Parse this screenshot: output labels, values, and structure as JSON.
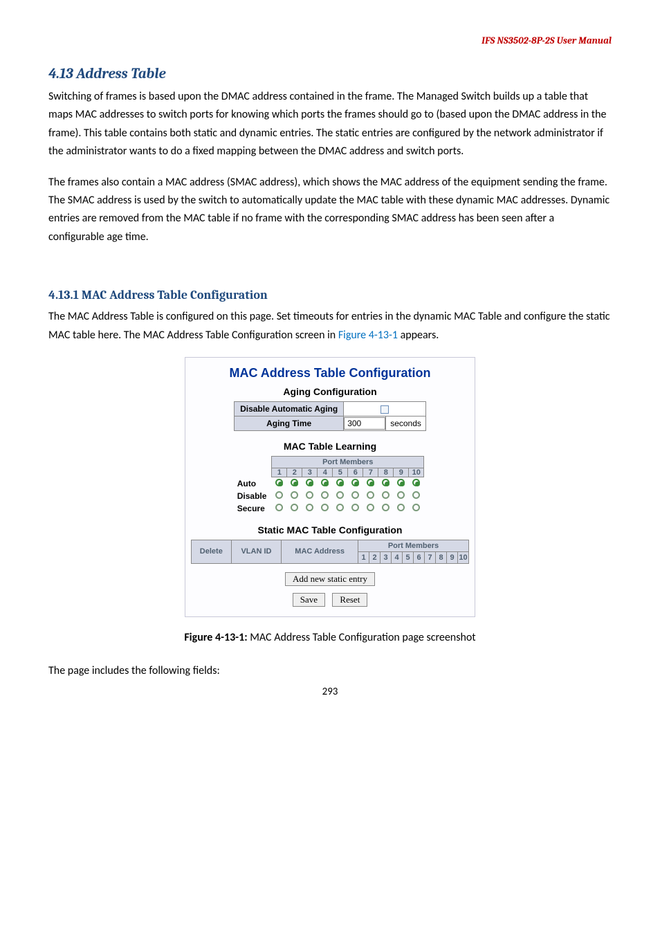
{
  "header": "IFS  NS3502-8P-2S  User  Manual",
  "section": {
    "heading": "4.13 Address Table",
    "para1": "Switching of frames is based upon the DMAC address contained in the frame. The Managed Switch builds up a table that maps MAC addresses to switch ports for knowing which ports the frames should go to (based upon the DMAC address in the frame). This table contains both static and dynamic entries. The static entries are configured by the network administrator if the administrator wants to do a fixed mapping between the DMAC address and switch ports.",
    "para2": "The frames also contain a MAC address (SMAC address), which shows the MAC address of the equipment sending the frame. The SMAC address is used by the switch to automatically update the MAC table with these dynamic MAC addresses. Dynamic entries are removed from the MAC table if no frame with the corresponding SMAC address has been seen after a configurable age time."
  },
  "subsection": {
    "heading": "4.13.1 MAC Address Table Configuration",
    "para_before_link": "The MAC Address Table is configured on this page. Set timeouts for entries in the dynamic MAC Table and configure the static MAC table here. The MAC Address Table Configuration screen in ",
    "figure_link": "Figure 4-13-1",
    "para_after_link": " appears."
  },
  "figure": {
    "title": "MAC Address Table Configuration",
    "aging_sub": "Aging Configuration",
    "aging_rows": {
      "disable_label": "Disable Automatic Aging",
      "time_label": "Aging Time",
      "time_value": "300",
      "time_unit": "seconds"
    },
    "learning_sub": "MAC Table Learning",
    "port_members_label": "Port Members",
    "port_numbers": [
      "1",
      "2",
      "3",
      "4",
      "5",
      "6",
      "7",
      "8",
      "9",
      "10"
    ],
    "learn_rows": [
      "Auto",
      "Disable",
      "Secure"
    ],
    "learn_selected_row": "Auto",
    "static_sub": "Static MAC Table Configuration",
    "static_headers": {
      "delete": "Delete",
      "vlan": "VLAN ID",
      "mac": "MAC Address"
    },
    "buttons": {
      "add": "Add new static entry",
      "save": "Save",
      "reset": "Reset"
    }
  },
  "caption_bold": "Figure 4-13-1:",
  "caption_rest": " MAC Address Table Configuration page screenshot",
  "trailing_line": "The page includes the following fields:",
  "page_number": "293"
}
